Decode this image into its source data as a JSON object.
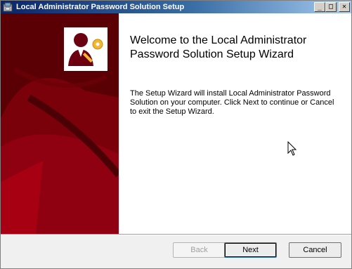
{
  "window": {
    "title": "Local Administrator Password Solution Setup",
    "icon": "installer-icon",
    "controls": {
      "minimize": "_",
      "maximize": "□",
      "close": "✕"
    }
  },
  "wizard": {
    "banner_colors": {
      "dark": "#5a0005",
      "light": "#8f0010"
    },
    "logo": "admin-key-icon",
    "heading": "Welcome to the Local Administrator Password Solution Setup Wizard",
    "body": "The Setup Wizard will install Local Administrator Password Solution on your computer. Click Next to continue or Cancel to exit the Setup Wizard."
  },
  "buttons": {
    "back": "Back",
    "next": "Next",
    "cancel": "Cancel"
  }
}
